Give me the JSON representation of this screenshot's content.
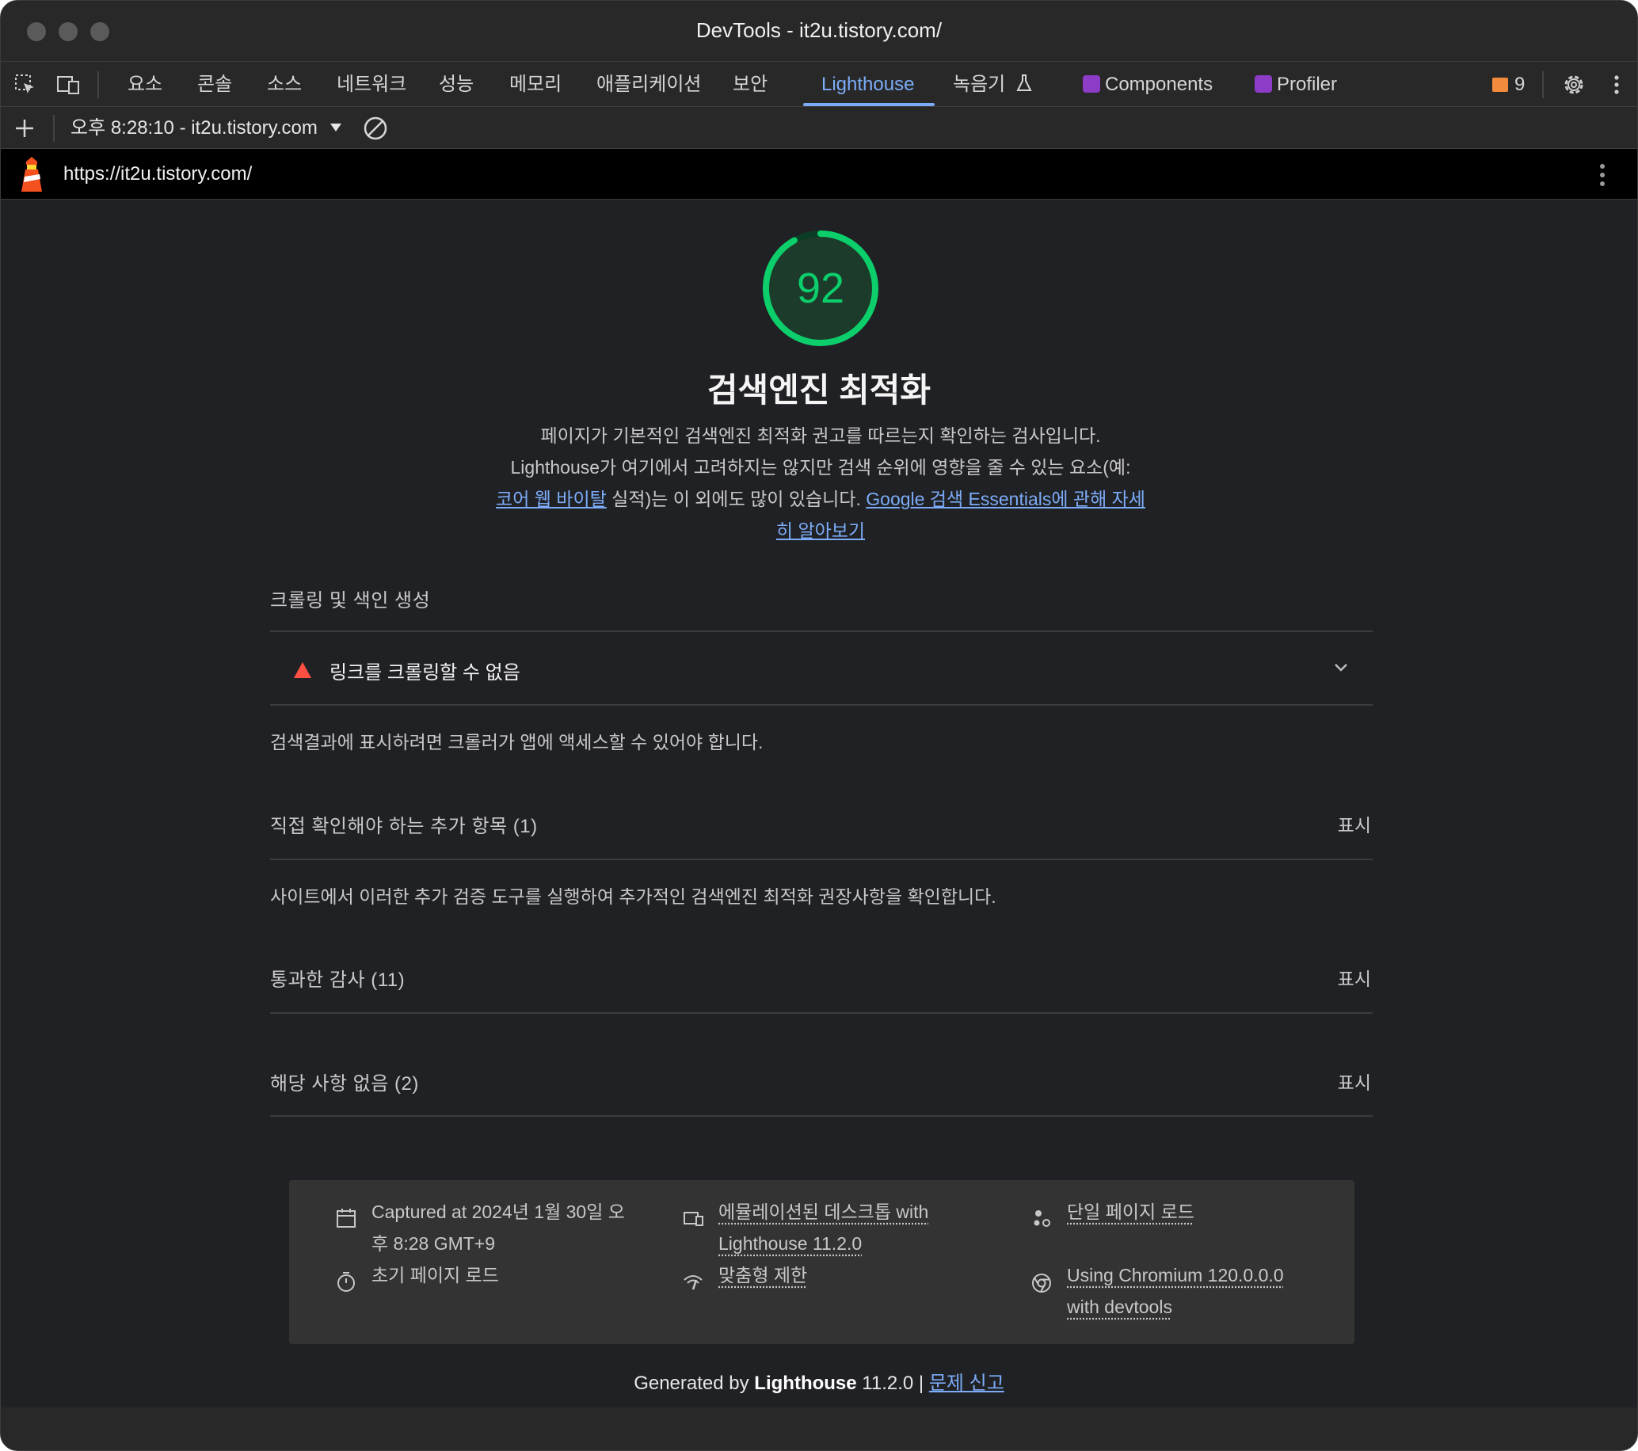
{
  "window": {
    "title": "DevTools - it2u.tistory.com/"
  },
  "tabs": [
    {
      "label": "요소"
    },
    {
      "label": "콘솔"
    },
    {
      "label": "소스"
    },
    {
      "label": "네트워크"
    },
    {
      "label": "성능"
    },
    {
      "label": "메모리"
    },
    {
      "label": "애플리케이션"
    },
    {
      "label": "보안"
    },
    {
      "label": "Lighthouse",
      "active": true
    },
    {
      "label": "녹음기"
    },
    {
      "label": "Components"
    },
    {
      "label": "Profiler"
    }
  ],
  "issues": {
    "count": "9"
  },
  "report_bar": {
    "selected_report": "오후 8:28:10 - it2u.tistory.com"
  },
  "url_bar": {
    "url": "https://it2u.tistory.com/"
  },
  "score": {
    "value": 92,
    "color": "#0cce6b"
  },
  "category": {
    "title": "검색엔진 최적화",
    "desc_line1": "페이지가 기본적인 검색엔진 최적화 권고를 따르는지 확인하는 검사입니다.",
    "desc_line2": "Lighthouse가 여기에서 고려하지는 않지만 검색 순위에 영향을 줄 수 있는 요소(예:",
    "desc_link1": "코어 웹 바이탈",
    "desc_line3": " 실적)는 이 외에도 많이 있습니다. ",
    "desc_link2": "Google 검색 Essentials에 관해 자세히 알아보기"
  },
  "groups": {
    "crawl": {
      "title": "크롤링 및 색인 생성",
      "audit_label": "링크를 크롤링할 수 없음",
      "description": "검색결과에 표시하려면 크롤러가 앱에 액세스할 수 있어야 합니다."
    },
    "manual": {
      "title": "직접 확인해야 하는 추가 항목 (1)",
      "show": "표시",
      "description": "사이트에서 이러한 추가 검증 도구를 실행하여 추가적인 검색엔진 최적화 권장사항을 확인합니다."
    },
    "passed": {
      "title": "통과한 감사 (11)",
      "show": "표시"
    },
    "notapplicable": {
      "title": "해당 사항 없음 (2)",
      "show": "표시"
    }
  },
  "runtime": {
    "captured_line1": "Captured at 2024년 1월 30일 오",
    "captured_line2": "후 8:28 GMT+9",
    "page_load": "초기 페이지 로드",
    "device_line1": "에뮬레이션된 데스크톱 with",
    "device_line2": "Lighthouse 11.2.0",
    "throttling": "맞춤형 제한",
    "single_page": "단일 페이지 로드",
    "browser_line1": "Using Chromium 120.0.0.0",
    "browser_line2": "with devtools"
  },
  "footer": {
    "generated_by": "Generated by ",
    "product": "Lighthouse",
    "version": " 11.2.0 | ",
    "report_issue": "문제 신고"
  }
}
